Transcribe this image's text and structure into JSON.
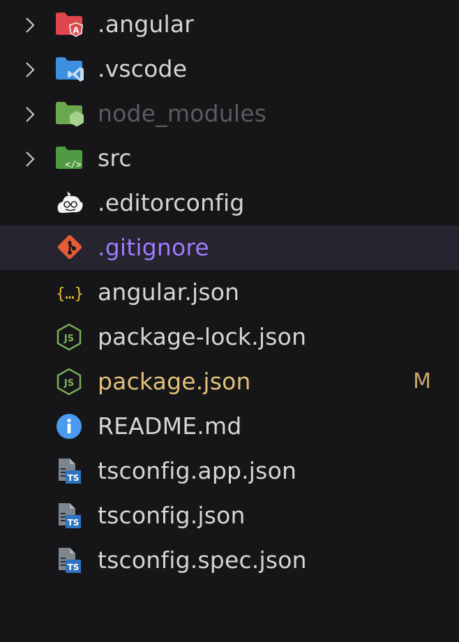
{
  "explorer": {
    "items": [
      {
        "label": ".angular",
        "icon": "angular-folder-icon"
      },
      {
        "label": ".vscode",
        "icon": "vscode-folder-icon"
      },
      {
        "label": "node_modules",
        "icon": "node-folder-icon"
      },
      {
        "label": "src",
        "icon": "src-folder-icon"
      },
      {
        "label": ".editorconfig",
        "icon": "editorconfig-icon"
      },
      {
        "label": ".gitignore",
        "icon": "git-icon"
      },
      {
        "label": "angular.json",
        "icon": "json-icon"
      },
      {
        "label": "package-lock.json",
        "icon": "nodejs-icon"
      },
      {
        "label": "package.json",
        "icon": "nodejs-icon",
        "badge": "M"
      },
      {
        "label": "README.md",
        "icon": "info-icon"
      },
      {
        "label": "tsconfig.app.json",
        "icon": "tsconfig-icon"
      },
      {
        "label": "tsconfig.json",
        "icon": "tsconfig-icon"
      },
      {
        "label": "tsconfig.spec.json",
        "icon": "tsconfig-icon"
      }
    ]
  },
  "colors": {
    "background": "#161618",
    "selected_row": "#26242e",
    "git_label": "#9b7bff",
    "modified_label": "#e2c07a",
    "modified_badge": "#c9a56a",
    "dim_label": "#5b5b60"
  }
}
